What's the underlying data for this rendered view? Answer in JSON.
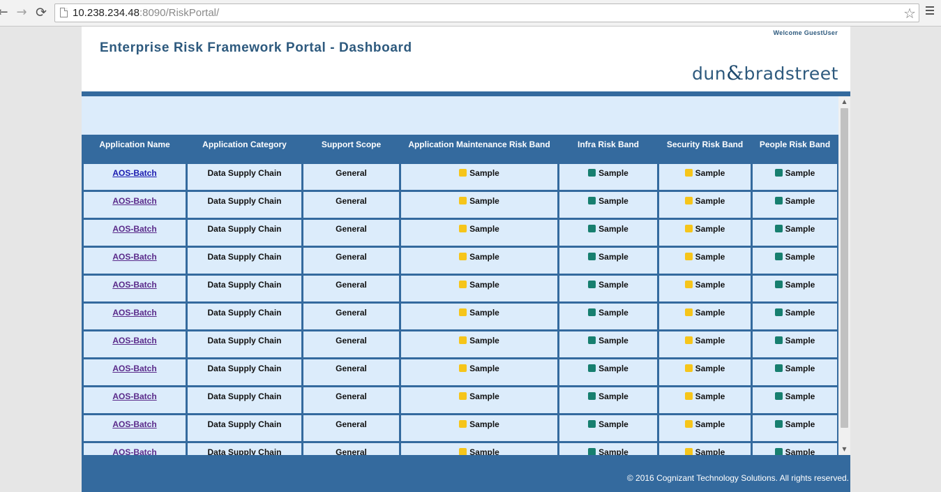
{
  "browser": {
    "url_host": "10.238.234.48",
    "url_rest": ":8090/RiskPortal/",
    "back_glyph": "←",
    "forward_glyph": "→",
    "reload_glyph": "⟳",
    "star_glyph": "☆"
  },
  "header": {
    "welcome": "Welcome GuestUser",
    "title": "Enterprise Risk Framework Portal - Dashboard",
    "logo_left": "dun",
    "logo_amp": "&",
    "logo_right": "bradstreet"
  },
  "table": {
    "columns": [
      "Application Name",
      "Application Category",
      "Support Scope",
      "Application Maintenance Risk Band",
      "Infra Risk Band",
      "Security Risk Band",
      "People Risk Band"
    ],
    "rows": [
      {
        "name": "AOS-Batch",
        "category": "Data Supply Chain",
        "scope": "General",
        "maint": "Sample",
        "infra": "Sample",
        "security": "Sample",
        "people": "Sample"
      },
      {
        "name": "AOS-Batch",
        "category": "Data Supply Chain",
        "scope": "General",
        "maint": "Sample",
        "infra": "Sample",
        "security": "Sample",
        "people": "Sample"
      },
      {
        "name": "AOS-Batch",
        "category": "Data Supply Chain",
        "scope": "General",
        "maint": "Sample",
        "infra": "Sample",
        "security": "Sample",
        "people": "Sample"
      },
      {
        "name": "AOS-Batch",
        "category": "Data Supply Chain",
        "scope": "General",
        "maint": "Sample",
        "infra": "Sample",
        "security": "Sample",
        "people": "Sample"
      },
      {
        "name": "AOS-Batch",
        "category": "Data Supply Chain",
        "scope": "General",
        "maint": "Sample",
        "infra": "Sample",
        "security": "Sample",
        "people": "Sample"
      },
      {
        "name": "AOS-Batch",
        "category": "Data Supply Chain",
        "scope": "General",
        "maint": "Sample",
        "infra": "Sample",
        "security": "Sample",
        "people": "Sample"
      },
      {
        "name": "AOS-Batch",
        "category": "Data Supply Chain",
        "scope": "General",
        "maint": "Sample",
        "infra": "Sample",
        "security": "Sample",
        "people": "Sample"
      },
      {
        "name": "AOS-Batch",
        "category": "Data Supply Chain",
        "scope": "General",
        "maint": "Sample",
        "infra": "Sample",
        "security": "Sample",
        "people": "Sample"
      },
      {
        "name": "AOS-Batch",
        "category": "Data Supply Chain",
        "scope": "General",
        "maint": "Sample",
        "infra": "Sample",
        "security": "Sample",
        "people": "Sample"
      },
      {
        "name": "AOS-Batch",
        "category": "Data Supply Chain",
        "scope": "General",
        "maint": "Sample",
        "infra": "Sample",
        "security": "Sample",
        "people": "Sample"
      },
      {
        "name": "AOS-Batch",
        "category": "Data Supply Chain",
        "scope": "General",
        "maint": "Sample",
        "infra": "Sample",
        "security": "Sample",
        "people": "Sample"
      }
    ]
  },
  "band_colors": {
    "maint": "#f6c51a",
    "infra": "#177f6f",
    "security": "#f6c51a",
    "people": "#177f6f"
  },
  "footer": {
    "copyright": "© 2016 Cognizant Technology Solutions. All rights reserved."
  }
}
